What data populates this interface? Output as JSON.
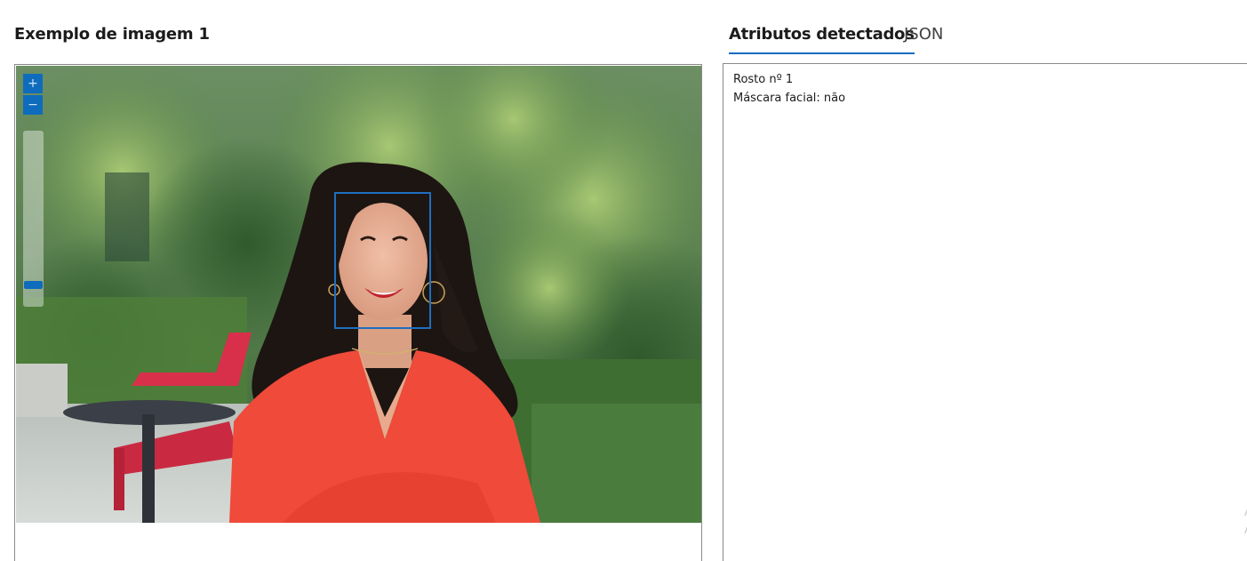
{
  "left_panel": {
    "title": "Exemplo de imagem 1",
    "zoom_in_label": "+",
    "zoom_out_label": "−"
  },
  "tabs": [
    {
      "label": "Atributos detectados",
      "active": true
    },
    {
      "label": "JSON",
      "active": false
    }
  ],
  "results": {
    "lines": [
      "Rosto nº 1",
      "Máscara facial: não"
    ],
    "edge_marks": [
      "A",
      "A"
    ]
  },
  "colors": {
    "accent": "#0f6cbd",
    "face_box": "#1f6fc0",
    "border": "#8a8a8a"
  }
}
